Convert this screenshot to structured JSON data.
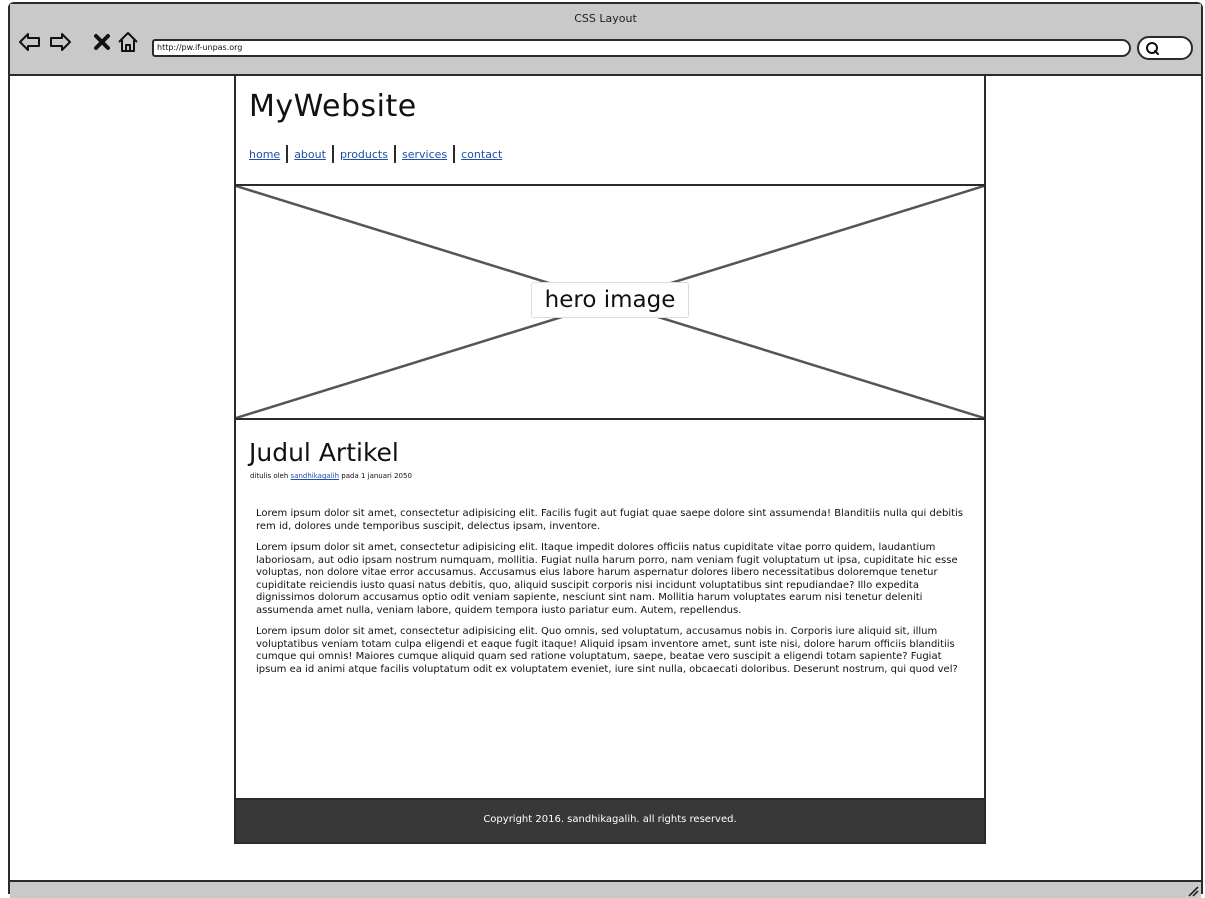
{
  "window": {
    "title": "CSS Layout",
    "url": "http://pw.if-unpas.org"
  },
  "icons": {
    "back": "arrow-left-icon",
    "forward": "arrow-right-icon",
    "stop": "close-icon",
    "home": "home-icon",
    "search": "search-icon",
    "resize": "resize-grip-icon"
  },
  "site": {
    "title": "MyWebsite",
    "nav": [
      {
        "label": "home"
      },
      {
        "label": "about"
      },
      {
        "label": "products"
      },
      {
        "label": "services"
      },
      {
        "label": "contact"
      }
    ]
  },
  "hero": {
    "label": "hero image"
  },
  "article": {
    "title": "Judul Artikel",
    "byline_prefix": "ditulis oleh",
    "author": "sandhikagalih",
    "byline_suffix": "pada 1 januari 2050",
    "paragraphs": [
      "Lorem ipsum dolor sit amet, consectetur adipisicing elit. Facilis fugit aut fugiat quae saepe dolore sint assumenda! Blanditiis nulla qui debitis rem id, dolores unde temporibus suscipit, delectus ipsam, inventore.",
      "Lorem ipsum dolor sit amet, consectetur adipisicing elit. Itaque impedit dolores officiis natus cupiditate vitae porro quidem, laudantium laboriosam, aut odio ipsam nostrum numquam, mollitia. Fugiat nulla harum porro, nam veniam fugit voluptatum ut ipsa, cupiditate hic esse voluptas, non dolore vitae error accusamus. Accusamus eius labore harum aspernatur dolores libero necessitatibus doloremque tenetur cupiditate reiciendis iusto quasi natus debitis, quo, aliquid suscipit corporis nisi incidunt voluptatibus sint repudiandae? Illo expedita dignissimos dolorum accusamus optio odit veniam sapiente, nesciunt sint nam. Mollitia harum voluptates earum nisi tenetur deleniti assumenda amet nulla, veniam labore, quidem tempora iusto pariatur eum. Autem, repellendus.",
      "Lorem ipsum dolor sit amet, consectetur adipisicing elit. Quo omnis, sed voluptatum, accusamus nobis in. Corporis iure aliquid sit, illum voluptatibus veniam totam culpa eligendi et eaque fugit itaque! Aliquid ipsam inventore amet, sunt iste nisi, dolore harum officiis blanditiis cumque qui omnis! Maiores cumque aliquid quam sed ratione voluptatum, saepe, beatae vero suscipit a eligendi totam sapiente? Fugiat ipsum ea id animi atque facilis voluptatum odit ex voluptatem eveniet, iure sint nulla, obcaecati doloribus. Deserunt nostrum, qui quod vel?"
    ]
  },
  "footer": {
    "text": "Copyright 2016. sandhikagalih. all rights reserved."
  },
  "colors": {
    "chrome": "#c9c9c9",
    "border": "#2b2b2b",
    "link": "#1f4fa8",
    "footer_bg": "#383838",
    "footer_text": "#ffffff"
  }
}
